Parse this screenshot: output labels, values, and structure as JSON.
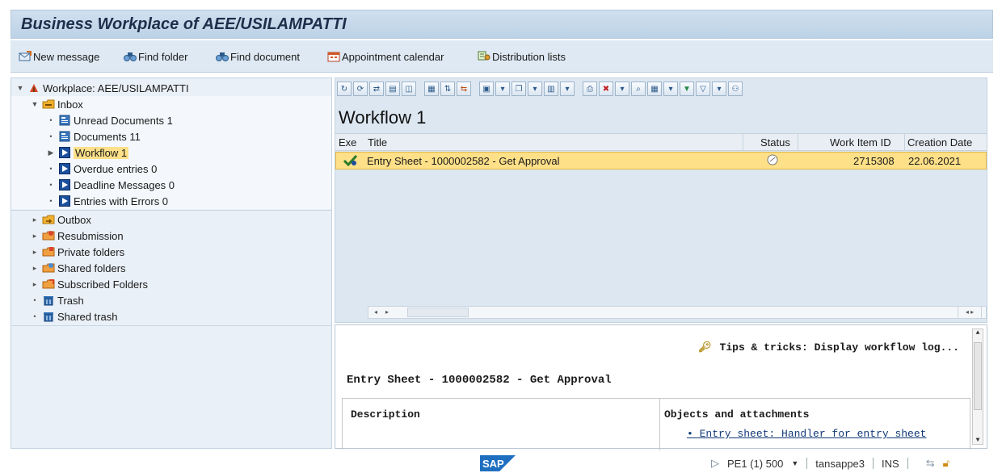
{
  "window_title": "Business Workplace of AEE/USILAMPATTI",
  "app_toolbar": [
    {
      "label": "New message",
      "icon": "new-message-icon"
    },
    {
      "label": "Find folder",
      "icon": "binoculars-icon"
    },
    {
      "label": "Find document",
      "icon": "binoculars-icon"
    },
    {
      "label": "Appointment calendar",
      "icon": "calendar-icon"
    },
    {
      "label": "Distribution lists",
      "icon": "distribution-list-icon"
    }
  ],
  "tree": {
    "root": "Workplace: AEE/USILAMPATTI",
    "inbox": "Inbox",
    "inbox_items": [
      {
        "label": "Unread Documents 1",
        "icon": "document-icon"
      },
      {
        "label": "Documents 11",
        "icon": "document-icon"
      },
      {
        "label": "Workflow 1",
        "icon": "workflow-icon",
        "selected": true
      },
      {
        "label": "Overdue entries 0",
        "icon": "workflow-icon"
      },
      {
        "label": "Deadline Messages 0",
        "icon": "workflow-icon"
      },
      {
        "label": "Entries with Errors 0",
        "icon": "workflow-icon"
      }
    ],
    "folders": [
      {
        "label": "Outbox",
        "icon": "outbox-icon"
      },
      {
        "label": "Resubmission",
        "icon": "folder-icon"
      },
      {
        "label": "Private folders",
        "icon": "folder-icon"
      },
      {
        "label": "Shared folders",
        "icon": "folder-icon"
      },
      {
        "label": "Subscribed Folders",
        "icon": "folder-icon"
      },
      {
        "label": "Trash",
        "icon": "trash-icon"
      },
      {
        "label": "Shared trash",
        "icon": "trash-icon"
      }
    ]
  },
  "list": {
    "title": "Workflow 1",
    "columns": {
      "exe": "Exe",
      "title": "Title",
      "status": "Status",
      "work_item_id": "Work Item ID",
      "creation_date": "Creation Date"
    },
    "rows": [
      {
        "title": "Entry Sheet - 1000002582 - Get Approval",
        "work_item_id": "2715308",
        "creation_date": "22.06.2021",
        "status_icon": "status-icon"
      }
    ]
  },
  "preview": {
    "tips": "Tips & tricks:  Display workflow log...",
    "heading": "Entry Sheet - 1000002582 - Get Approval",
    "description_label": "Description",
    "objects_label": "Objects and attachments",
    "object_link": "• Entry sheet: Handler for entry sheet"
  },
  "status_bar": {
    "system": "PE1 (1) 500",
    "server": "tansappe3",
    "mode": "INS"
  },
  "colors": {
    "selection": "#fde088",
    "title_bg": "#cfe0ef"
  }
}
